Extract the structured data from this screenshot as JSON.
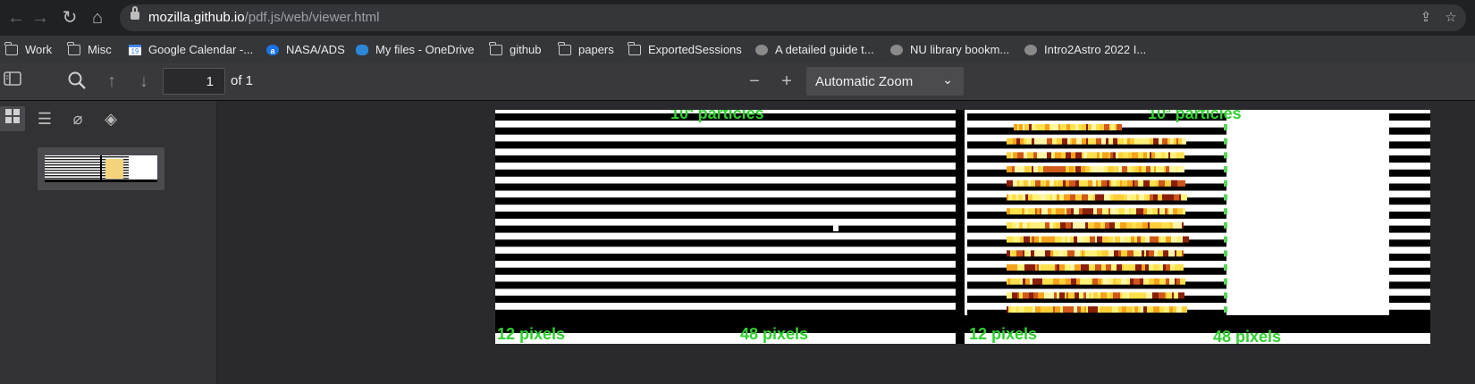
{
  "browser": {
    "url_host": "mozilla.github.io",
    "url_path": "/pdf.js/web/viewer.html"
  },
  "bookmarks": [
    {
      "label": "Work",
      "icon": "folder-icon"
    },
    {
      "label": "Misc",
      "icon": "folder-icon"
    },
    {
      "label": "Google Calendar -...",
      "icon": "calendar-icon"
    },
    {
      "label": "NASA/ADS",
      "icon": "ads-icon"
    },
    {
      "label": "My files - OneDrive",
      "icon": "onedrive-icon"
    },
    {
      "label": "github",
      "icon": "folder-icon"
    },
    {
      "label": "papers",
      "icon": "folder-icon"
    },
    {
      "label": "ExportedSessions",
      "icon": "folder-icon"
    },
    {
      "label": "A detailed guide t...",
      "icon": "globe-icon"
    },
    {
      "label": "NU library bookm...",
      "icon": "globe-icon"
    },
    {
      "label": "Intro2Astro 2022 I...",
      "icon": "globe-icon"
    }
  ],
  "toolbar": {
    "page_number": "1",
    "page_of": "of 1",
    "zoom_label": "Automatic Zoom",
    "zoom_chevron": "⌄"
  },
  "document": {
    "panel_left_title": "10⁴ particles",
    "panel_right_title": "10⁵ particles",
    "panel_left_base": "10",
    "panel_left_exp": "4",
    "panel_right_base": "10",
    "panel_right_exp": "5",
    "particles_word": "particles",
    "label_12px_left": "12 pixels",
    "label_48px_left": "48 pixels",
    "label_12px_right": "12 pixels",
    "label_48px_right": "48 pixels",
    "accent_color": "#2fd12f"
  }
}
